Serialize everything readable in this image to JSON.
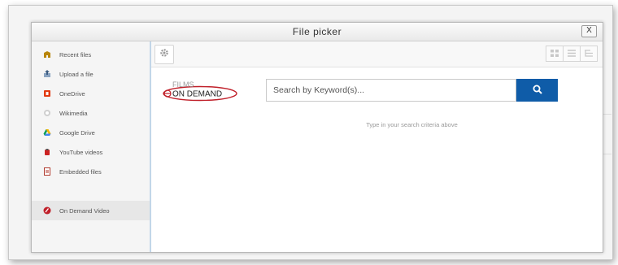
{
  "dialog": {
    "title": "File picker",
    "close_label": "X"
  },
  "sidebar": {
    "items": [
      {
        "label": "Recent files",
        "icon": "recent-files-icon",
        "color": "#b8860b"
      },
      {
        "label": "Upload a file",
        "icon": "upload-file-icon",
        "color": "#5a7aa0"
      },
      {
        "label": "OneDrive",
        "icon": "onedrive-icon",
        "color": "#e23b12"
      },
      {
        "label": "Wikimedia",
        "icon": "wikimedia-icon",
        "color": "#999999"
      },
      {
        "label": "Google Drive",
        "icon": "google-drive-icon",
        "color": "#3b7de0"
      },
      {
        "label": "YouTube videos",
        "icon": "youtube-icon",
        "color": "#cc2222"
      },
      {
        "label": "Embedded files",
        "icon": "embedded-files-icon",
        "color": "#b03a2e"
      },
      {
        "label": "On Demand Video",
        "icon": "on-demand-video-icon",
        "color": "#c0202a"
      }
    ]
  },
  "toolbar": {
    "settings_icon": "gear-icon",
    "views": [
      "grid-view-icon",
      "list-view-icon",
      "tree-view-icon"
    ]
  },
  "logo": {
    "line1": "FILMS",
    "line2": "ON DEMAND",
    "color": "#c0202a"
  },
  "search": {
    "placeholder": "Search by Keyword(s)...",
    "button_icon": "search-icon",
    "button_color": "#0f5ca8",
    "hint": "Type in your search criteria above"
  }
}
